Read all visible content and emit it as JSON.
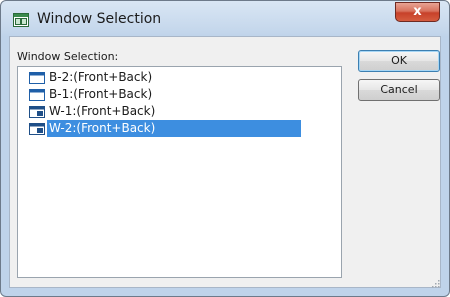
{
  "window": {
    "title": "Window Selection",
    "close_label": "x"
  },
  "list": {
    "label": "Window Selection:",
    "items": [
      {
        "label": "B-2:(Front+Back)",
        "icon": "window-icon",
        "selected": false
      },
      {
        "label": "B-1:(Front+Back)",
        "icon": "window-icon",
        "selected": false
      },
      {
        "label": "W-1:(Front+Back)",
        "icon": "window-tiled-icon",
        "selected": false
      },
      {
        "label": "W-2:(Front+Back)",
        "icon": "window-tiled-icon",
        "selected": true
      }
    ]
  },
  "buttons": {
    "ok": "OK",
    "cancel": "Cancel"
  },
  "colors": {
    "selection": "#3d8ee0",
    "close_button": "#c7412a",
    "window_icon": "#1f5fa8"
  }
}
